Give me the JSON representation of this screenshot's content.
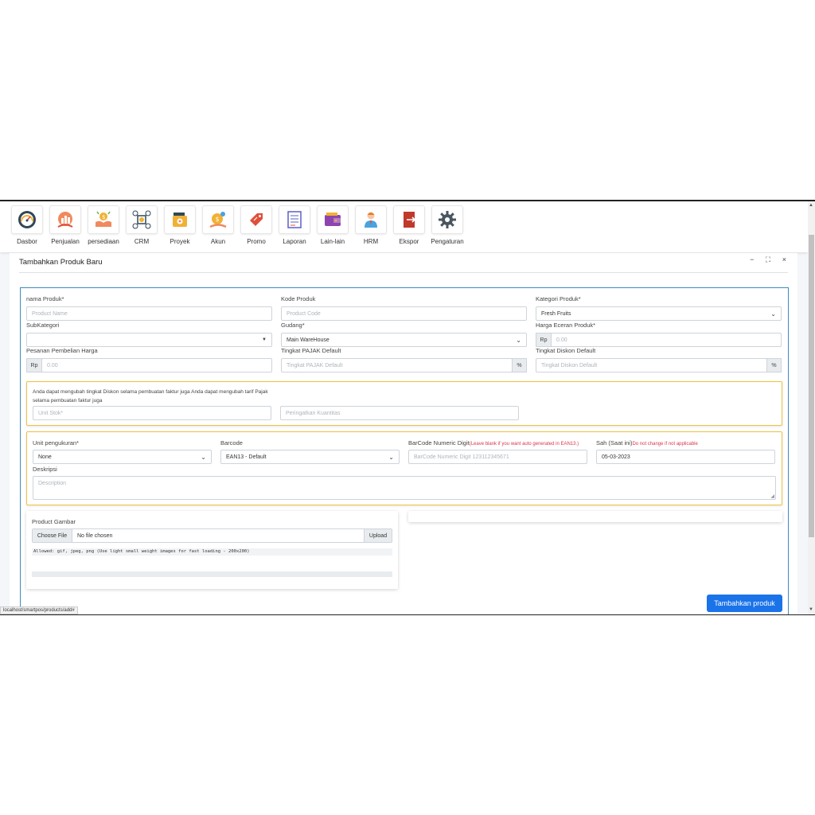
{
  "nav": {
    "items": [
      {
        "label": "Dasbor"
      },
      {
        "label": "Penjualan"
      },
      {
        "label": "persediaan"
      },
      {
        "label": "CRM"
      },
      {
        "label": "Proyek"
      },
      {
        "label": "Akun"
      },
      {
        "label": "Promo"
      },
      {
        "label": "Laporan"
      },
      {
        "label": "Lain-lain"
      },
      {
        "label": "HRM"
      },
      {
        "label": "Ekspor"
      },
      {
        "label": "Pengaturan"
      }
    ]
  },
  "form": {
    "title": "Tambahkan Produk Baru",
    "window_controls": {
      "minimize": "−",
      "maximize": "⛶",
      "close": "×"
    },
    "product_name": {
      "label": "nama Produk*",
      "placeholder": "Product Name"
    },
    "product_code": {
      "label": "Kode Produk",
      "placeholder": "Product Code"
    },
    "category": {
      "label": "Kategori Produk*",
      "value": "Fresh Fruits"
    },
    "subcategory": {
      "label": "SubKategori",
      "value": ""
    },
    "warehouse": {
      "label": "Gudang*",
      "value": "Main WareHouse"
    },
    "retail_price": {
      "label": "Harga Eceran Produk*",
      "prefix": "Rp",
      "placeholder": "0.00"
    },
    "purchase_price": {
      "label": "Pesanan Pembelian Harga",
      "prefix": "Rp",
      "placeholder": "0.00"
    },
    "tax_rate": {
      "label": "Tingkat PAJAK Default",
      "placeholder": "Tingkat PAJAK Default",
      "suffix": "%"
    },
    "discount_rate": {
      "label": "Tingkat Diskon Default",
      "placeholder": "Tingkat Diskon Default",
      "suffix": "%"
    },
    "info_text_1": "Anda dapat mengubah tingkat Diskon selama pembuatan faktur juga Anda dapat mengubah tarif Pajak",
    "info_text_2": "selama pembuatan faktur juga",
    "stock_unit": {
      "placeholder": "Unit Stok*"
    },
    "qty_alert": {
      "placeholder": "Peringatkan Kuantitas"
    },
    "unit": {
      "label": "Unit pengukuran*",
      "value": "None"
    },
    "barcode": {
      "label": "Barcode",
      "value": "EAN13 - Default"
    },
    "barcode_digit": {
      "label": "BarCode Numeric Digit",
      "note": "(Leave blank if you want auto generated in EAN13.)",
      "placeholder": "BarCode Numeric Digit 123112345671"
    },
    "valid": {
      "label": "Sah (Saat ini)",
      "note": "Do not change if not applicable",
      "value": "05-03-2023"
    },
    "description": {
      "label": "Deskripsi",
      "placeholder": "Description"
    },
    "image": {
      "label": "Product Gambar",
      "choose_label": "Choose File",
      "file_text": "No file chosen",
      "upload_label": "Upload",
      "allowed_text": "Allowed: gif, jpeg, png (Use light small weight images for fast loading - 200x200)"
    },
    "submit_label": "Tambahkan produk"
  },
  "status_bar": {
    "url": "localhost/smartpos/products/add#"
  },
  "colors": {
    "primary": "#1a73e8",
    "box_border": "#f0c040",
    "card_border": "#3c8dbc",
    "note_red": "#dc3545"
  }
}
